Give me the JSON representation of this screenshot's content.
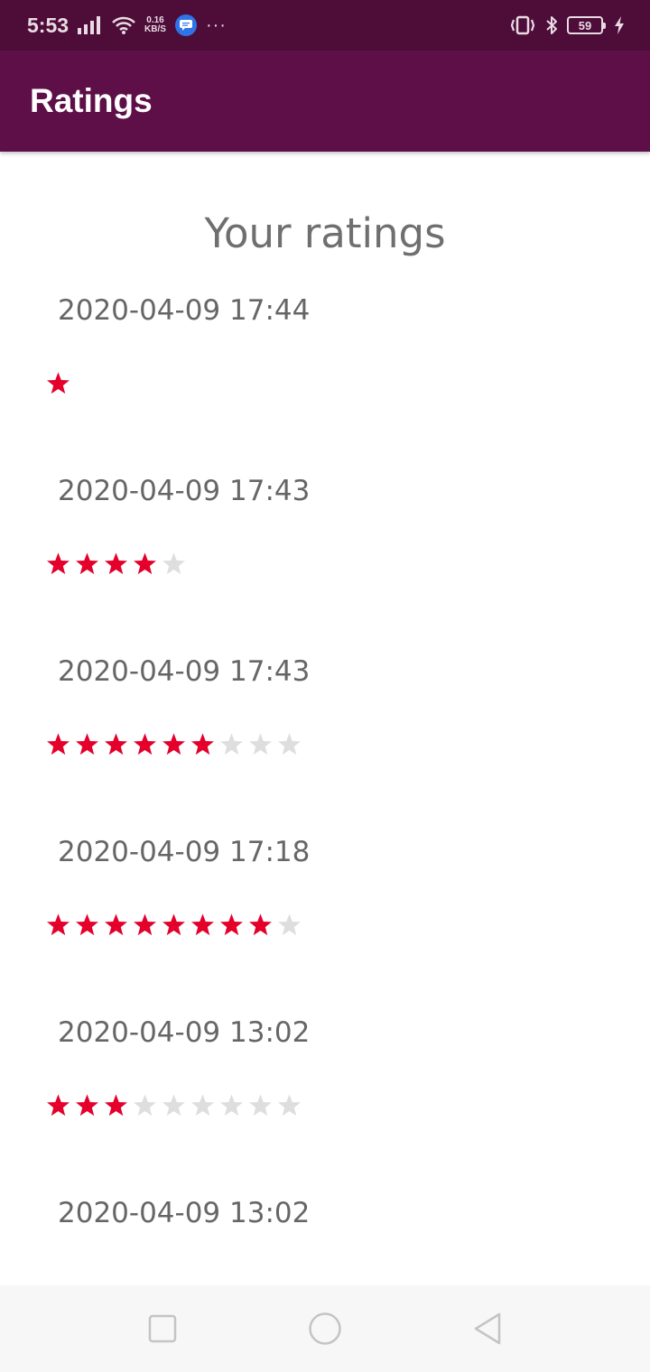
{
  "status_bar": {
    "time": "5:53",
    "net_speed_value": "0.16",
    "net_speed_unit": "KB/S",
    "more": "···",
    "battery": "59",
    "icons": [
      "signal-icon",
      "wifi-icon",
      "messages-icon",
      "vibrate-icon",
      "bluetooth-icon",
      "battery-icon",
      "charging-icon"
    ]
  },
  "app_bar": {
    "title": "Ratings"
  },
  "main": {
    "heading": "Your ratings",
    "star_color_filled": "#e4002b",
    "star_color_empty": "#dedede",
    "ratings": [
      {
        "date": "2020-04-09 17:44",
        "rating": 1,
        "max": 1
      },
      {
        "date": "2020-04-09 17:43",
        "rating": 4,
        "max": 5
      },
      {
        "date": "2020-04-09 17:43",
        "rating": 6,
        "max": 9
      },
      {
        "date": "2020-04-09 17:18",
        "rating": 8,
        "max": 9
      },
      {
        "date": "2020-04-09 13:02",
        "rating": 3,
        "max": 9
      },
      {
        "date": "2020-04-09 13:02",
        "rating": null,
        "max": null
      }
    ]
  },
  "nav_bar": {
    "buttons": [
      "recents-square-icon",
      "home-circle-icon",
      "back-triangle-icon"
    ]
  }
}
